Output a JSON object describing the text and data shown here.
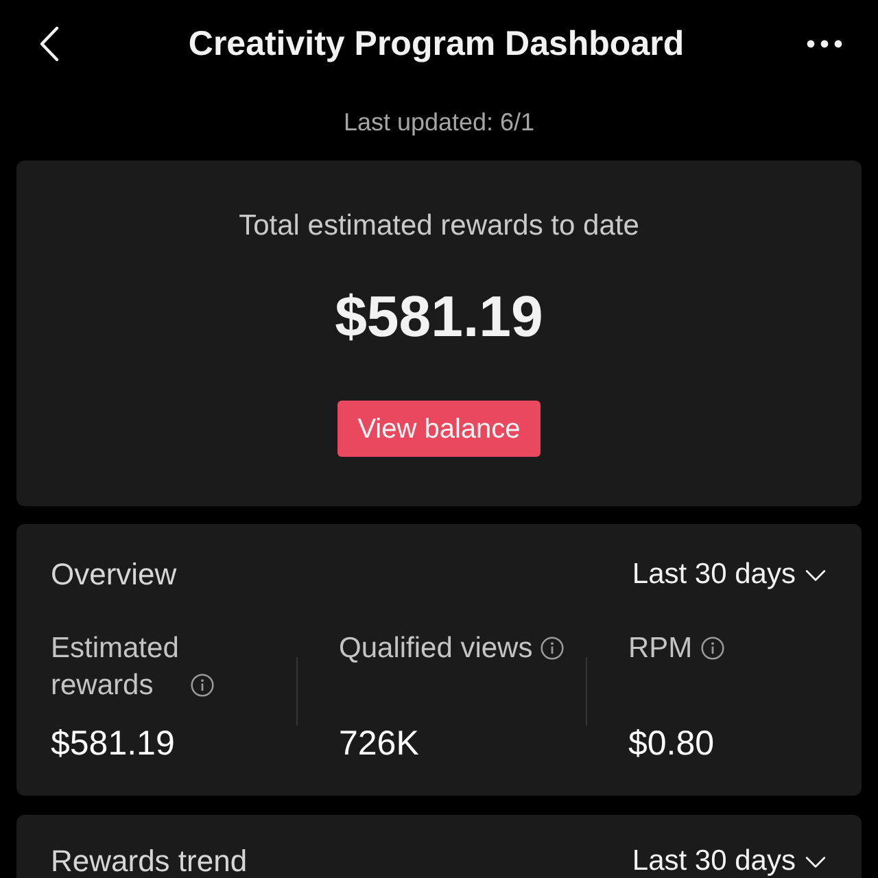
{
  "header": {
    "title": "Creativity Program Dashboard",
    "last_updated": "Last updated: 6/1"
  },
  "total_card": {
    "label": "Total estimated rewards to date",
    "amount": "$581.19",
    "button": "View balance"
  },
  "overview": {
    "title": "Overview",
    "period": "Last 30 days",
    "metrics": [
      {
        "label": "Estimated rewards",
        "value": "$581.19",
        "info": true
      },
      {
        "label": "Qualified views",
        "value": "726K",
        "info": true
      },
      {
        "label": "RPM",
        "value": "$0.80",
        "info": true
      }
    ]
  },
  "rewards_trend": {
    "title": "Rewards trend",
    "period": "Last 30 days"
  }
}
